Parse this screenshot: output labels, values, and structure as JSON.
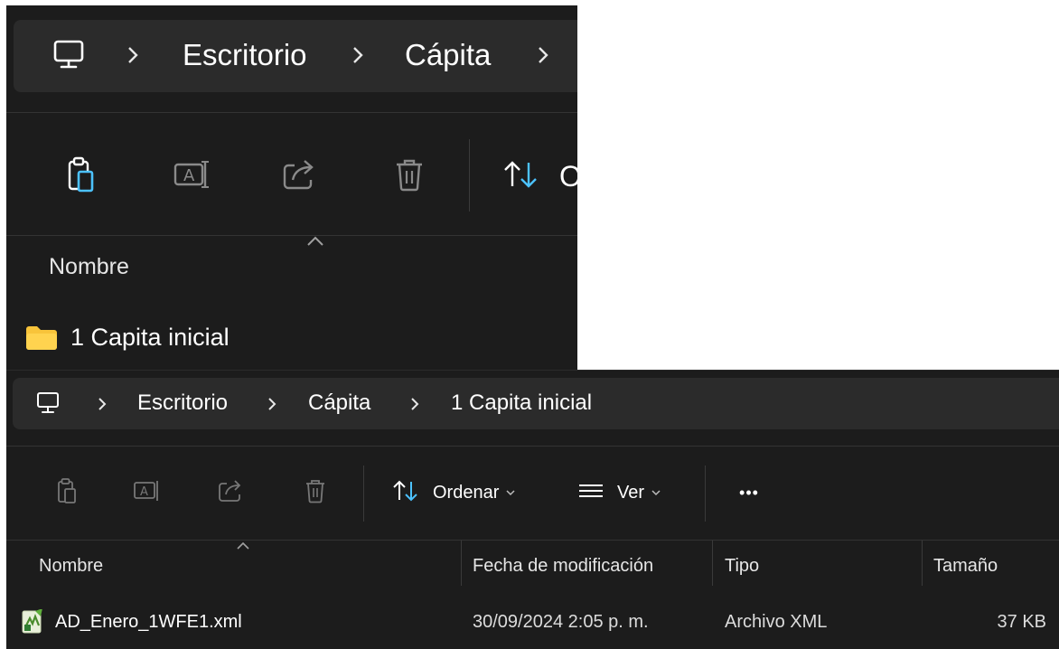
{
  "window_top": {
    "breadcrumb": [
      "Escritorio",
      "Cápita"
    ],
    "column_header": "Nombre",
    "rows": [
      {
        "name": "1 Capita inicial",
        "icon": "folder-icon"
      }
    ]
  },
  "window_bottom": {
    "breadcrumb": [
      "Escritorio",
      "Cápita",
      "1 Capita inicial"
    ],
    "toolbar": {
      "sort_label": "Ordenar",
      "view_label": "Ver",
      "more_label": "•••"
    },
    "columns": {
      "name": "Nombre",
      "modified": "Fecha de modificación",
      "type": "Tipo",
      "size": "Tamaño"
    },
    "rows": [
      {
        "name": "AD_Enero_1WFE1.xml",
        "modified": "30/09/2024 2:05 p. m.",
        "type": "Archivo XML",
        "size": "37 KB",
        "icon": "xml-file-icon"
      }
    ]
  },
  "colors": {
    "window_bg": "#1c1c1c",
    "address_bg": "#2b2b2b",
    "accent": "#4cc2ff",
    "folder": "#f8c43a"
  }
}
